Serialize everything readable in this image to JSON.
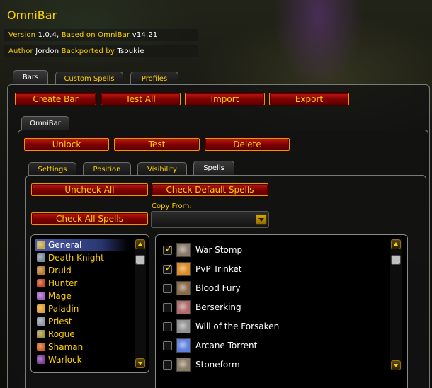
{
  "window": {
    "title": "OmniBar",
    "version_label": "Version",
    "version": "1.0.4,",
    "based_label": "Based on OmniBar",
    "based_version": "v14.21",
    "author_label": "Author",
    "author": "Jordon",
    "backport_label": "Backported by",
    "backporter": "Tsoukie"
  },
  "top_tabs": [
    {
      "label": "Bars",
      "active": true
    },
    {
      "label": "Custom Spells",
      "active": false
    },
    {
      "label": "Profiles",
      "active": false
    }
  ],
  "bars_toolbar": {
    "create": "Create Bar",
    "test_all": "Test All",
    "import": "Import",
    "export": "Export"
  },
  "bar_tab": {
    "label": "OmniBar"
  },
  "bar_actions": {
    "unlock": "Unlock",
    "test": "Test",
    "delete": "Delete"
  },
  "sub_tabs": [
    {
      "label": "Settings",
      "active": false
    },
    {
      "label": "Position",
      "active": false
    },
    {
      "label": "Visibility",
      "active": false
    },
    {
      "label": "Spells",
      "active": true
    }
  ],
  "spells_panel": {
    "uncheck_all": "Uncheck All",
    "check_default": "Check Default Spells",
    "check_all": "Check All Spells",
    "copy_from_label": "Copy From:",
    "copy_from_value": ""
  },
  "classes": [
    {
      "label": "General",
      "selected": true,
      "icon": "general-icon",
      "color": "#c8a848"
    },
    {
      "label": "Death Knight",
      "selected": false,
      "icon": "death-knight-icon",
      "color": "#7a8a9a"
    },
    {
      "label": "Druid",
      "selected": false,
      "icon": "druid-icon",
      "color": "#b87a30"
    },
    {
      "label": "Hunter",
      "selected": false,
      "icon": "hunter-icon",
      "color": "#c84a20"
    },
    {
      "label": "Mage",
      "selected": false,
      "icon": "mage-icon",
      "color": "#a060c0"
    },
    {
      "label": "Paladin",
      "selected": false,
      "icon": "paladin-icon",
      "color": "#e0a030"
    },
    {
      "label": "Priest",
      "selected": false,
      "icon": "priest-icon",
      "color": "#9098a8"
    },
    {
      "label": "Rogue",
      "selected": false,
      "icon": "rogue-icon",
      "color": "#a09040"
    },
    {
      "label": "Shaman",
      "selected": false,
      "icon": "shaman-icon",
      "color": "#d06020"
    },
    {
      "label": "Warlock",
      "selected": false,
      "icon": "warlock-icon",
      "color": "#8040a0"
    }
  ],
  "spells": [
    {
      "label": "War Stomp",
      "checked": true,
      "icon": "war-stomp-icon",
      "color": "#8a7a6a"
    },
    {
      "label": "PvP Trinket",
      "checked": true,
      "icon": "pvp-trinket-icon",
      "color": "#e08a20"
    },
    {
      "label": "Blood Fury",
      "checked": false,
      "icon": "blood-fury-icon",
      "color": "#8a6a4a"
    },
    {
      "label": "Berserking",
      "checked": false,
      "icon": "berserking-icon",
      "color": "#b06a6a"
    },
    {
      "label": "Will of the Forsaken",
      "checked": false,
      "icon": "will-of-the-forsaken-icon",
      "color": "#909090"
    },
    {
      "label": "Arcane Torrent",
      "checked": false,
      "icon": "arcane-torrent-icon",
      "color": "#6080e0"
    },
    {
      "label": "Stoneform",
      "checked": false,
      "icon": "stoneform-icon",
      "color": "#8a7a60"
    }
  ]
}
